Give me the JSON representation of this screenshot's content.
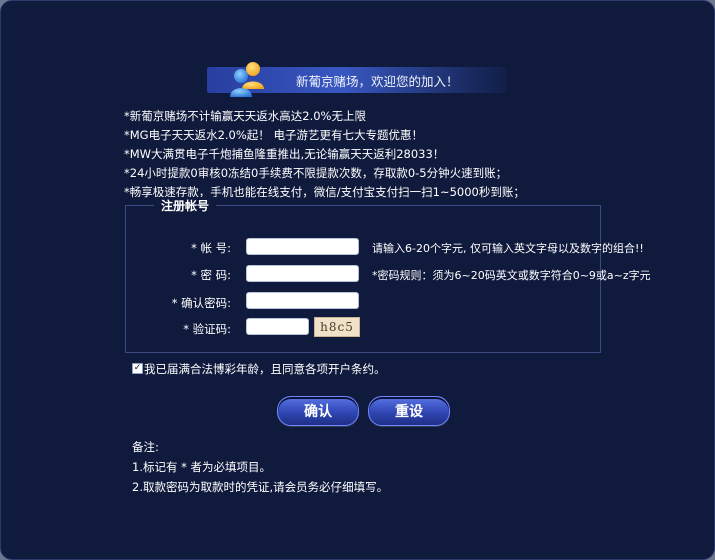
{
  "header": {
    "welcome_text": "新葡京赌场，欢迎您的加入！"
  },
  "notices": [
    "*新葡京赌场不计输赢天天返水高达2.0%无上限",
    "*MG电子天天返水2.0%起！ 电子游艺更有七大专题优惠！",
    "*MW大满贯电子千炮捕鱼隆重推出,无论输赢天天返利28033！",
    "*24小时提款0审核0冻结0手续费不限提款次数，存取款0-5分钟火速到账；",
    "*畅享极速存款，手机也能在线支付，微信/支付宝支付扫一扫1~5000秒到账；"
  ],
  "form": {
    "legend": "注册帐号",
    "account_label": "* 帐 号:",
    "account_value": "",
    "account_hint": "请输入6-20个字元, 仅可输入英文字母以及数字的组合!!",
    "password_label": "* 密 码:",
    "password_value": "",
    "password_hint": "*密码规则：须为6~20码英文或数字符合0~9或a~z字元",
    "confirm_label": "* 确认密码:",
    "confirm_value": "",
    "captcha_label": "* 验证码:",
    "captcha_value": "",
    "captcha_image_text": "h8c5"
  },
  "agreement": {
    "checked": true,
    "text": "我已届满合法博彩年龄，且同意各项开户条约。"
  },
  "buttons": {
    "confirm_label": "确认",
    "reset_label": "重设"
  },
  "footer": {
    "title": "备注:",
    "items": [
      "1.标记有 * 者为必填项目。",
      "2.取款密码为取款时的凭证,请会员务必仔细填写。"
    ]
  },
  "colors": {
    "background": "#0f1a3d",
    "accent": "#3a5bd0"
  }
}
